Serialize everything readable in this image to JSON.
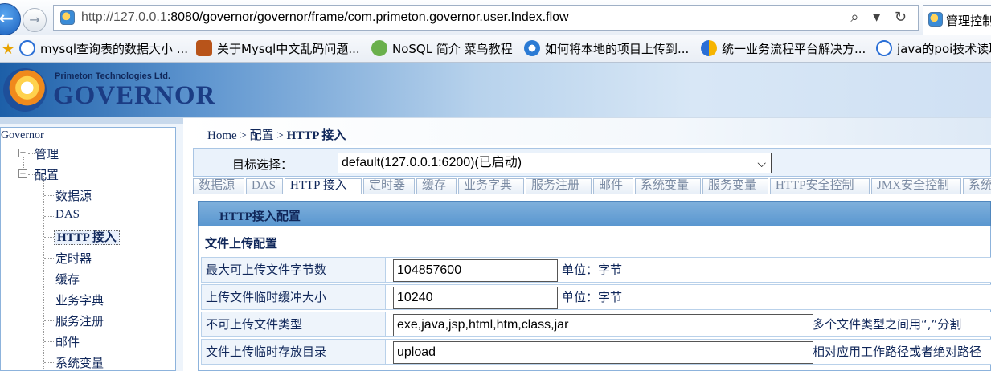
{
  "browser": {
    "url_prefix": "http://127.0.0.1",
    "url_rest": ":8080/governor/governor/frame/com.primeton.governor.user.Index.flow",
    "url_icons": "⌕ ▾ ↻",
    "tab_title": "管理控制台"
  },
  "bookmarks": [
    "mysql查询表的数据大小 ...",
    "关于Mysql中文乱码问题...",
    "NoSQL 简介 菜鸟教程",
    "如何将本地的项目上传到...",
    "统一业务流程平台解决方...",
    "java的poi技术读取"
  ],
  "header": {
    "company": "Primeton Technologies Ltd.",
    "product": "GOVERNOR"
  },
  "tree": {
    "root": "Governor",
    "nodes": [
      {
        "label": "管理",
        "expander": "+"
      },
      {
        "label": "配置",
        "expander": "−"
      }
    ],
    "leaves": [
      "数据源",
      "DAS",
      "HTTP 接入",
      "定时器",
      "缓存",
      "业务字典",
      "服务注册",
      "邮件",
      "系统变量"
    ],
    "selected": "HTTP 接入"
  },
  "breadcrumb": {
    "home": "Home",
    "sep1": ">",
    "level1": "配置",
    "sep2": ">",
    "current": "HTTP 接入"
  },
  "target": {
    "label": "目标选择：",
    "value": "default(127.0.0.1:6200)(已启动)"
  },
  "tabs": [
    "数据源",
    "DAS",
    "HTTP 接入",
    "定时器",
    "缓存",
    "业务字典",
    "服务注册",
    "邮件",
    "系统变量",
    "服务变量",
    "HTTP安全控制",
    "JMX安全控制",
    "系统"
  ],
  "active_tab": "HTTP 接入",
  "config": {
    "title": "HTTP接入配置",
    "section": "文件上传配置",
    "rows": [
      {
        "label": "最大可上传文件字节数",
        "value": "104857600",
        "note": "单位：字节"
      },
      {
        "label": "上传文件临时缓冲大小",
        "value": "10240",
        "note": "单位：字节"
      },
      {
        "label": "不可上传文件类型",
        "value": "exe,java,jsp,html,htm,class,jar",
        "note": "多个文件类型之间用“,”分割"
      },
      {
        "label": "文件上传临时存放目录",
        "value": "upload",
        "note": "相对应用工作路径或者绝对路径"
      }
    ]
  }
}
